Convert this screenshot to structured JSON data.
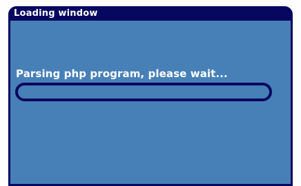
{
  "window": {
    "title": "Loading window"
  },
  "loader": {
    "message": "Parsing php program, please wait...",
    "progress_fraction": 0
  },
  "colors": {
    "title_bar": "#06075f",
    "panel": "#4780b7",
    "text": "#ffffff",
    "page_background": "#fefeff"
  }
}
